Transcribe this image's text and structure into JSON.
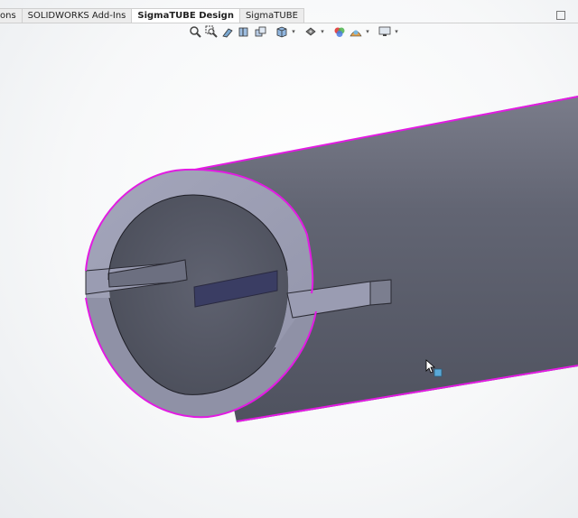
{
  "tabs": [
    {
      "label": "ons",
      "active": false
    },
    {
      "label": "SOLIDWORKS Add-Ins",
      "active": false
    },
    {
      "label": "SigmaTUBE Design",
      "active": true
    },
    {
      "label": "SigmaTUBE",
      "active": false
    }
  ],
  "heads_up_toolbar": [
    {
      "icon": "zoom-to-fit-icon",
      "caret": false
    },
    {
      "icon": "zoom-to-area-icon",
      "caret": false
    },
    {
      "icon": "previous-view-icon",
      "caret": false
    },
    {
      "icon": "section-view-icon",
      "caret": false
    },
    {
      "icon": "dynamic-annotation-views-icon",
      "caret": false
    },
    {
      "icon": "view-orientation-icon",
      "caret": true
    },
    {
      "icon": "display-style-icon",
      "caret": true
    },
    {
      "icon": "hide-show-items-icon",
      "caret": false
    },
    {
      "icon": "edit-appearance-icon",
      "caret": false
    },
    {
      "icon": "apply-scene-icon",
      "caret": true
    },
    {
      "icon": "view-settings-icon",
      "caret": true
    }
  ],
  "colors": {
    "tube_outer": "#5d6070",
    "tube_face": "#9a9cb2",
    "tube_inner": "#5a5d6b",
    "selection_edge": "#e21be2",
    "slot_face": "#3a3d63"
  }
}
